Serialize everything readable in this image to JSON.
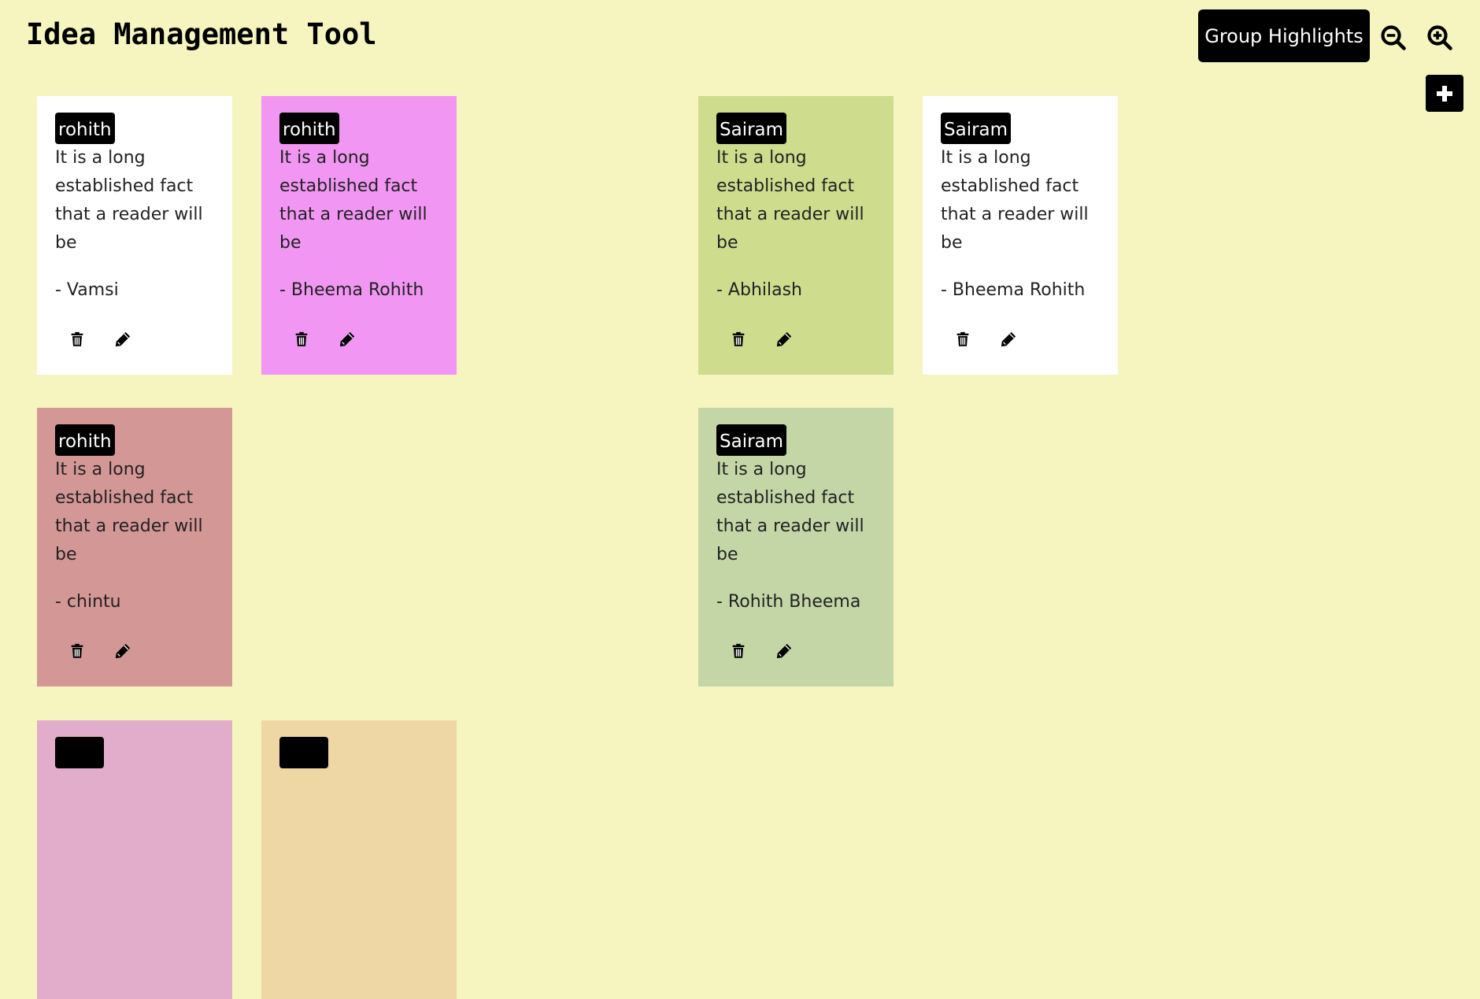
{
  "header": {
    "title": "Idea Management Tool",
    "group_highlights_label": "Group Highlights"
  },
  "colors": {
    "background": "#f6f5bf"
  },
  "cards": [
    {
      "user": "rohith",
      "text": "It is a long established fact that a reader will be",
      "author": "- Vamsi",
      "color": "#ffffff"
    },
    {
      "user": "rohith",
      "text": "It is a long established fact that a reader will be",
      "author": "- Bheema Rohith",
      "color": "#f197f3"
    },
    {
      "user": "Sairam",
      "text": "It is a long established fact that a reader will be",
      "author": "- Abhilash",
      "color": "#cddc8d"
    },
    {
      "user": "Sairam",
      "text": "It is a long established fact that a reader will be",
      "author": "- Bheema Rohith",
      "color": "#ffffff"
    },
    {
      "user": "rohith",
      "text": "It is a long established fact that a reader will be",
      "author": "- chintu",
      "color": "#d39795"
    },
    {
      "user": "Sairam",
      "text": "It is a long established fact that a reader will be",
      "author": "- Rohith Bheema",
      "color": "#c4d6a6"
    },
    {
      "color": "#e2accb"
    },
    {
      "color": "#eed6a5"
    }
  ]
}
